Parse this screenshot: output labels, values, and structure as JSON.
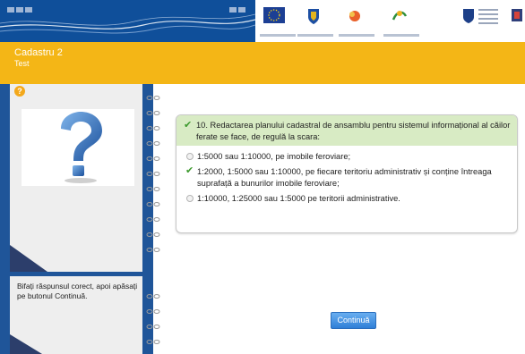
{
  "header": {
    "logos": [
      {
        "icon": "eu-flag-logo"
      },
      {
        "icon": "romania-coat-of-arms-logo"
      },
      {
        "icon": "program-logo-red"
      },
      {
        "icon": "program-logo-green"
      },
      {
        "icon": "ministry-logo"
      },
      {
        "icon": "university-crest-logo"
      }
    ]
  },
  "titlebar": {
    "title": "Cadastru 2",
    "subtitle": "Test"
  },
  "sidebar": {
    "help_icon": "?",
    "instruction": "Bifați răspunsul corect, apoi apăsați pe butonul Continuă."
  },
  "question": {
    "text": "10. Redactarea planului cadastral de ansamblu pentru sistemul informațional al căilor ferate se face, de regulă la scara:",
    "options": [
      {
        "label": "1:5000 sau 1:10000, pe imobile feroviare;",
        "selected": false
      },
      {
        "label": "1:2000, 1:5000 sau 1:10000, pe fiecare teritoriu administrativ și conține întreaga suprafață a bunurilor imobile feroviare;",
        "selected": true
      },
      {
        "label": "1:10000, 1:25000 sau 1:5000 pe teritorii administrative.",
        "selected": false
      }
    ]
  },
  "actions": {
    "continue_label": "Continuă"
  },
  "colors": {
    "header_blue": "#0f4f9a",
    "titlebar_orange": "#f4b616",
    "question_header_green": "#d8ebc4",
    "check_green": "#3d9a2e",
    "button_blue": "#2f7fd7"
  }
}
